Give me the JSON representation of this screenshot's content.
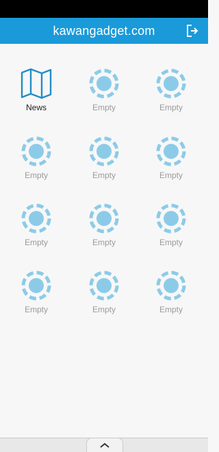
{
  "header": {
    "title": "kawangadget.com",
    "logout_icon": "logout-icon"
  },
  "tiles": [
    {
      "label": "News",
      "icon": "map-icon",
      "active": true
    },
    {
      "label": "Empty",
      "icon": "empty-slot-icon"
    },
    {
      "label": "Empty",
      "icon": "empty-slot-icon"
    },
    {
      "label": "Empty",
      "icon": "empty-slot-icon"
    },
    {
      "label": "Empty",
      "icon": "empty-slot-icon"
    },
    {
      "label": "Empty",
      "icon": "empty-slot-icon"
    },
    {
      "label": "Empty",
      "icon": "empty-slot-icon"
    },
    {
      "label": "Empty",
      "icon": "empty-slot-icon"
    },
    {
      "label": "Empty",
      "icon": "empty-slot-icon"
    },
    {
      "label": "Empty",
      "icon": "empty-slot-icon"
    },
    {
      "label": "Empty",
      "icon": "empty-slot-icon"
    },
    {
      "label": "Empty",
      "icon": "empty-slot-icon"
    }
  ],
  "bottom": {
    "handle_icon": "chevron-up-icon"
  },
  "colors": {
    "accent": "#1a9ad9",
    "icon": "#8ccbe8",
    "map_icon": "#1f8fc6"
  }
}
